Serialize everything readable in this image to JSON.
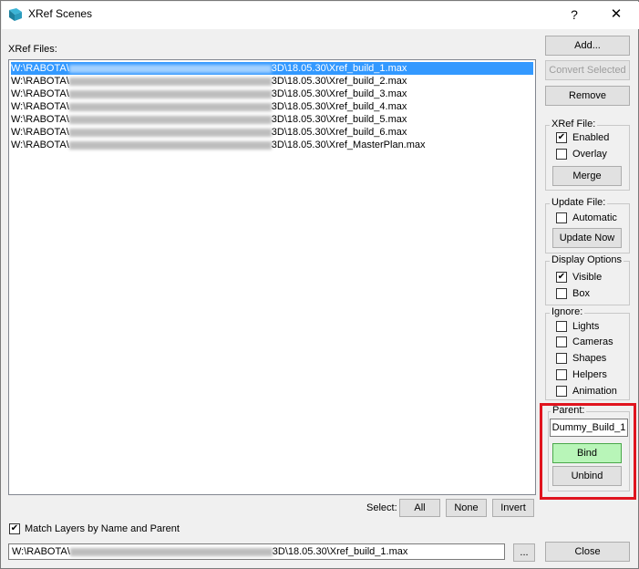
{
  "window": {
    "title": "XRef Scenes",
    "help_label": "?",
    "close_label": "✕"
  },
  "files": {
    "label": "XRef Files:",
    "rows": [
      {
        "prefix": "W:\\RABOTA\\",
        "suffix": "3D\\18.05.30\\Xref_build_1.max",
        "selected": true
      },
      {
        "prefix": "W:\\RABOTA\\",
        "suffix": "3D\\18.05.30\\Xref_build_2.max",
        "selected": false
      },
      {
        "prefix": "W:\\RABOTA\\",
        "suffix": "3D\\18.05.30\\Xref_build_3.max",
        "selected": false
      },
      {
        "prefix": "W:\\RABOTA\\",
        "suffix": "3D\\18.05.30\\Xref_build_4.max",
        "selected": false
      },
      {
        "prefix": "W:\\RABOTA\\",
        "suffix": "3D\\18.05.30\\Xref_build_5.max",
        "selected": false
      },
      {
        "prefix": "W:\\RABOTA\\",
        "suffix": "3D\\18.05.30\\Xref_build_6.max",
        "selected": false
      },
      {
        "prefix": "W:\\RABOTA\\",
        "suffix": "3D\\18.05.30\\Xref_MasterPlan.max",
        "selected": false
      }
    ]
  },
  "select": {
    "label": "Select:",
    "all": "All",
    "none": "None",
    "invert": "Invert"
  },
  "match_layers": {
    "label": "Match Layers by Name and Parent",
    "checked": true
  },
  "path_field": {
    "prefix": "W:\\RABOTA\\",
    "suffix": "3D\\18.05.30\\Xref_build_1.max",
    "browse_label": "..."
  },
  "buttons": {
    "add": "Add...",
    "convert_selected": "Convert Selected",
    "remove": "Remove",
    "close": "Close"
  },
  "xref_file": {
    "legend": "XRef File:",
    "enabled": "Enabled",
    "enabled_checked": true,
    "overlay": "Overlay",
    "overlay_checked": false,
    "merge": "Merge"
  },
  "update_file": {
    "legend": "Update File:",
    "automatic": "Automatic",
    "automatic_checked": false,
    "update_now": "Update Now"
  },
  "display_options": {
    "legend": "Display Options",
    "visible": "Visible",
    "visible_checked": true,
    "box": "Box",
    "box_checked": false
  },
  "ignore": {
    "legend": "Ignore:",
    "lights": "Lights",
    "cameras": "Cameras",
    "shapes": "Shapes",
    "helpers": "Helpers",
    "animation": "Animation"
  },
  "parent": {
    "legend": "Parent:",
    "value": "Dummy_Build_1",
    "bind": "Bind",
    "unbind": "Unbind"
  },
  "colors": {
    "selection": "#3399ff",
    "bind_button": "#b8f5b8",
    "highlight_border": "#e0141e"
  },
  "icons": {
    "app": "3ds-max-logo-icon",
    "check": "✔"
  }
}
